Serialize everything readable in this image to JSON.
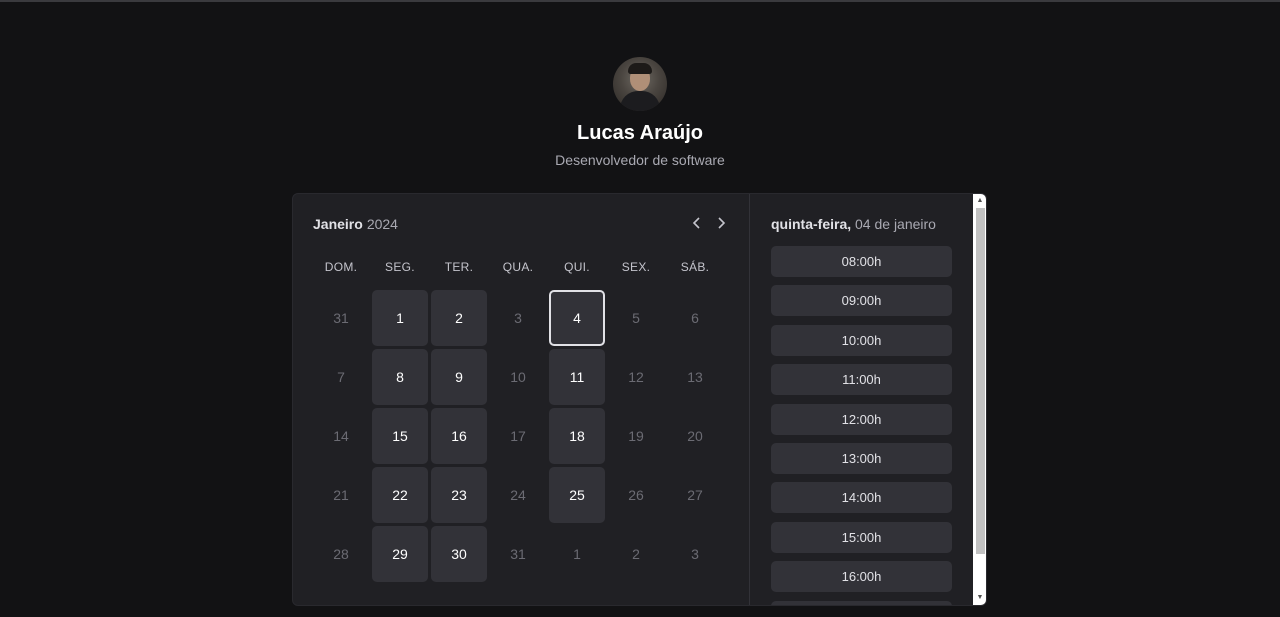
{
  "profile": {
    "name": "Lucas Araújo",
    "bio": "Desenvolvedor de software"
  },
  "calendar": {
    "month": "Janeiro",
    "year": "2024",
    "prev_icon": "chevron-left-icon",
    "next_icon": "chevron-right-icon",
    "weekdays": [
      "DOM.",
      "SEG.",
      "TER.",
      "QUA.",
      "QUI.",
      "SEX.",
      "SÁB."
    ],
    "weeks": [
      [
        {
          "d": "31",
          "s": "muted"
        },
        {
          "d": "1",
          "s": "avail"
        },
        {
          "d": "2",
          "s": "avail"
        },
        {
          "d": "3",
          "s": "muted"
        },
        {
          "d": "4",
          "s": "selected"
        },
        {
          "d": "5",
          "s": "muted"
        },
        {
          "d": "6",
          "s": "muted"
        }
      ],
      [
        {
          "d": "7",
          "s": "muted"
        },
        {
          "d": "8",
          "s": "avail"
        },
        {
          "d": "9",
          "s": "avail"
        },
        {
          "d": "10",
          "s": "muted"
        },
        {
          "d": "11",
          "s": "avail"
        },
        {
          "d": "12",
          "s": "muted"
        },
        {
          "d": "13",
          "s": "muted"
        }
      ],
      [
        {
          "d": "14",
          "s": "muted"
        },
        {
          "d": "15",
          "s": "avail"
        },
        {
          "d": "16",
          "s": "avail"
        },
        {
          "d": "17",
          "s": "muted"
        },
        {
          "d": "18",
          "s": "avail"
        },
        {
          "d": "19",
          "s": "muted"
        },
        {
          "d": "20",
          "s": "muted"
        }
      ],
      [
        {
          "d": "21",
          "s": "muted"
        },
        {
          "d": "22",
          "s": "avail"
        },
        {
          "d": "23",
          "s": "avail"
        },
        {
          "d": "24",
          "s": "muted"
        },
        {
          "d": "25",
          "s": "avail"
        },
        {
          "d": "26",
          "s": "muted"
        },
        {
          "d": "27",
          "s": "muted"
        }
      ],
      [
        {
          "d": "28",
          "s": "muted"
        },
        {
          "d": "29",
          "s": "avail"
        },
        {
          "d": "30",
          "s": "avail"
        },
        {
          "d": "31",
          "s": "muted"
        },
        {
          "d": "1",
          "s": "muted"
        },
        {
          "d": "2",
          "s": "muted"
        },
        {
          "d": "3",
          "s": "muted"
        }
      ]
    ]
  },
  "times": {
    "weekday": "quinta-feira,",
    "date": "04 de janeiro",
    "slots": [
      "08:00h",
      "09:00h",
      "10:00h",
      "11:00h",
      "12:00h",
      "13:00h",
      "14:00h",
      "15:00h",
      "16:00h",
      ""
    ]
  },
  "colors": {
    "background": "#121214",
    "card": "#202024",
    "available_day": "#323238",
    "muted_text": "#6b6b73"
  }
}
